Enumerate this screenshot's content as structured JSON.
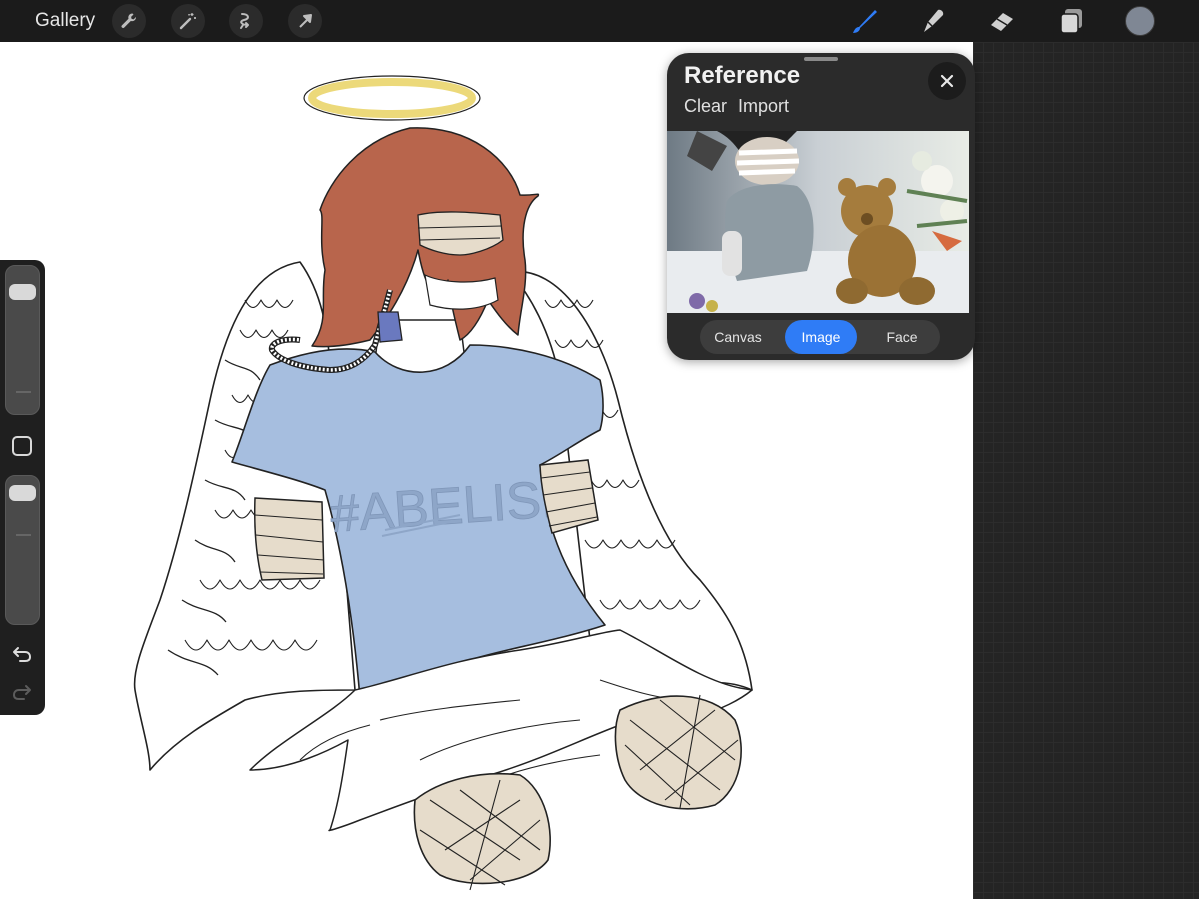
{
  "topbar": {
    "gallery_label": "Gallery",
    "left_tools": [
      "wrench-icon",
      "magic-wand-icon",
      "selection-icon",
      "transform-arrow-icon"
    ],
    "right_tools": [
      "brush-icon",
      "smudge-icon",
      "eraser-icon",
      "layers-icon"
    ],
    "active_tool": "brush-icon",
    "active_tool_color": "#2f7cf6",
    "current_color": "#7f8794"
  },
  "sidebar": {
    "size_slider_level": 0.88,
    "opacity_slider_level": 0.05
  },
  "reference_panel": {
    "title": "Reference",
    "clear_label": "Clear",
    "import_label": "Import",
    "segments": [
      {
        "label": "Canvas",
        "active": false
      },
      {
        "label": "Image",
        "active": true
      },
      {
        "label": "Face",
        "active": false
      }
    ]
  },
  "canvas": {
    "shirt_text": "#ABELISM",
    "colors": {
      "hair": "#b8654c",
      "shirt": "#a6bedf",
      "bandage": "#e6dccb",
      "halo": "#ecd97a",
      "oxygen_tube": "#6a79bf"
    }
  }
}
